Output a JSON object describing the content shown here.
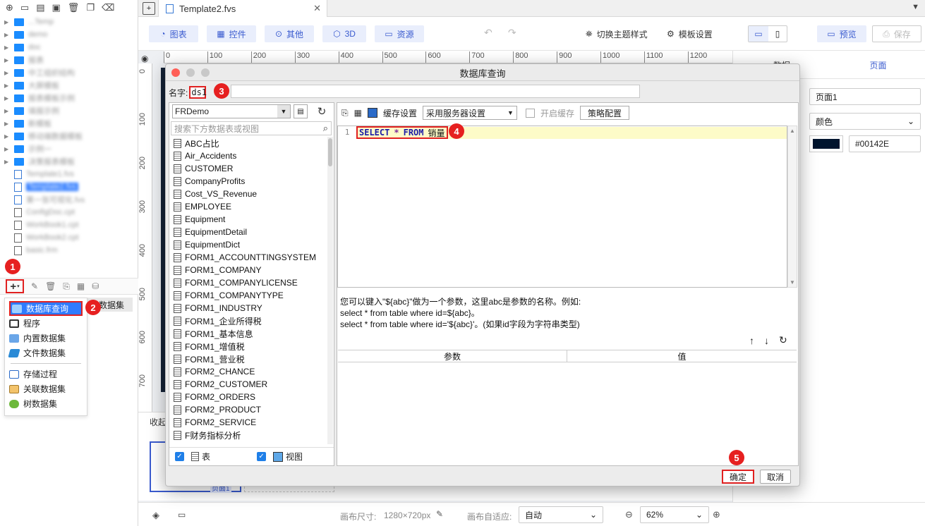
{
  "tab": {
    "title": "Template2.fvs"
  },
  "toolbar": {
    "chart": "图表",
    "widget": "控件",
    "other": "其他",
    "three_d": "3D",
    "resource": "资源",
    "switch_theme": "切换主题样式",
    "template_settings": "模板设置",
    "preview": "预览",
    "save": "保存"
  },
  "ruler": {
    "h": [
      "0",
      "100",
      "200",
      "300",
      "400",
      "500",
      "600",
      "700",
      "800",
      "900",
      "1000",
      "1100",
      "1200"
    ],
    "v": [
      "0",
      "100",
      "200",
      "300",
      "400",
      "500",
      "600",
      "700"
    ]
  },
  "left_panel": {
    "files": [
      {
        "type": "folder",
        "name": "...Temp"
      },
      {
        "type": "folder",
        "name": "demo"
      },
      {
        "type": "folder",
        "name": "doc"
      },
      {
        "type": "folder",
        "name": "报表"
      },
      {
        "type": "folder",
        "name": "中工组织结构"
      },
      {
        "type": "folder",
        "name": "大屏模板"
      },
      {
        "type": "folder",
        "name": "报表模板示例"
      },
      {
        "type": "folder",
        "name": "填报示例"
      },
      {
        "type": "folder",
        "name": "新模板"
      },
      {
        "type": "folder",
        "name": "移动端数据模板"
      },
      {
        "type": "folder",
        "name": "示例一"
      },
      {
        "type": "folder",
        "name": "决策报表模板"
      },
      {
        "type": "tpl",
        "name": "Template1.fvs"
      },
      {
        "type": "tpl",
        "name": "Template2.fvs",
        "selected": true
      },
      {
        "type": "tpl",
        "name": "第一张可视化.fvs"
      },
      {
        "type": "file",
        "name": "ConfigDoc.cpt"
      },
      {
        "type": "file",
        "name": "WorkBook1.cpt"
      },
      {
        "type": "file",
        "name": "WorkBook2.cpt"
      },
      {
        "type": "file",
        "name": "basic.frm"
      }
    ],
    "menu": {
      "db_query": "数据库查询",
      "program": "程序",
      "builtin": "内置数据集",
      "file_ds": "文件数据集",
      "stored_proc": "存储过程",
      "related_ds": "关联数据集",
      "tree_ds": "树数据集"
    },
    "ds_tail": "数据集",
    "collapse": "收起",
    "page_thumb": "页面1"
  },
  "badges": [
    "1",
    "2",
    "3",
    "4",
    "5"
  ],
  "dialog": {
    "title": "数据库查询",
    "name_label": "名字:",
    "name_value": "ds1",
    "connection": "FRDemo",
    "search_placeholder": "搜索下方数据表或视图",
    "tables": [
      "ABC占比",
      "Air_Accidents",
      "CUSTOMER",
      "CompanyProfits",
      "Cost_VS_Revenue",
      "EMPLOYEE",
      "Equipment",
      "EquipmentDetail",
      "EquipmentDict",
      "FORM1_ACCOUNTTINGSYSTEM",
      "FORM1_COMPANY",
      "FORM1_COMPANYLICENSE",
      "FORM1_COMPANYTYPE",
      "FORM1_INDUSTRY",
      "FORM1_企业所得税",
      "FORM1_基本信息",
      "FORM1_增值税",
      "FORM1_营业税",
      "FORM2_CHANCE",
      "FORM2_CUSTOMER",
      "FORM2_ORDERS",
      "FORM2_PRODUCT",
      "FORM2_SERVICE",
      "F财务指标分析"
    ],
    "show_table": "表",
    "show_view": "视图",
    "cache_label": "缓存设置",
    "cache_value": "采用服务器设置",
    "enable_cache": "开启缓存",
    "policy": "策略配置",
    "sql": {
      "line": "1",
      "select": "SELECT",
      "star": "*",
      "from": "FROM",
      "table": "销量"
    },
    "hint": [
      "您可以键入\"${abc}\"做为一个参数，这里abc是参数的名称。例如:",
      "select * from table where id=${abc}。",
      "select * from table where id='${abc}'。(如果id字段为字符串类型)"
    ],
    "param_col": "参数",
    "value_col": "值",
    "ok": "确定",
    "cancel": "取消"
  },
  "right_panel": {
    "tab_data": "数据",
    "tab_page": "页面",
    "page_name": "页面1",
    "fill_type": "颜色",
    "color_hex": "#00142E",
    "color_value": "#00142E"
  },
  "status": {
    "canvas_size_label": "画布尺寸:",
    "canvas_size": "1280×720px",
    "adapt_label": "画布自适应:",
    "adapt_value": "自动",
    "zoom": "62%"
  }
}
